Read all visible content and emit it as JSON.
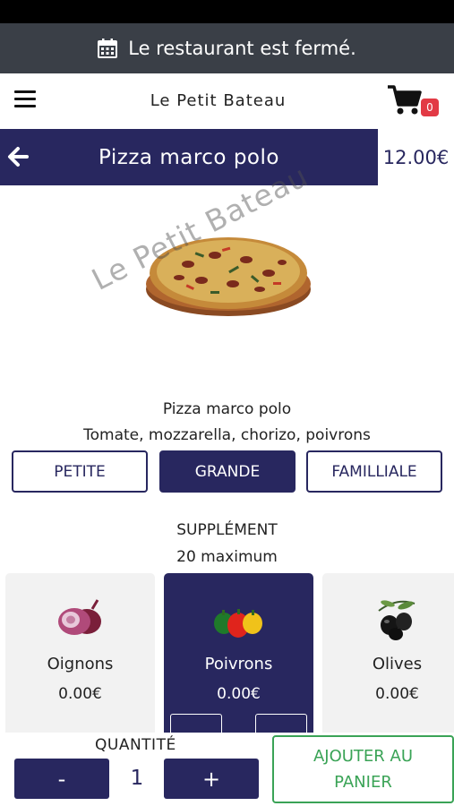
{
  "banner": {
    "text": "Le restaurant est fermé.",
    "icon": "calendar-icon"
  },
  "header": {
    "brand": "Le Petit Bateau",
    "cart_count": "0"
  },
  "product": {
    "title": "Pizza marco polo",
    "price": "12.00€",
    "watermark": "Le Petit Bateau",
    "name": "Pizza marco polo",
    "description": "Tomate, mozzarella, chorizo, poivrons"
  },
  "sizes": [
    {
      "label": "PETITE",
      "selected": false
    },
    {
      "label": "GRANDE",
      "selected": true
    },
    {
      "label": "FAMILLIALE",
      "selected": false
    }
  ],
  "supplements": {
    "title": "SUPPLÉMENT",
    "max": "20 maximum",
    "items": [
      {
        "name": "Oignons",
        "price": "0.00€",
        "icon": "onion-icon",
        "selected": false
      },
      {
        "name": "Poivrons",
        "price": "0.00€",
        "icon": "pepper-icon",
        "selected": true
      },
      {
        "name": "Olives",
        "price": "0.00€",
        "icon": "olive-icon",
        "selected": false
      }
    ]
  },
  "footer": {
    "quantity_label": "QUANTITÉ",
    "minus": "-",
    "quantity": "1",
    "plus": "+",
    "add_line1": "AJOUTER AU",
    "add_line2": "PANIER"
  },
  "colors": {
    "primary": "#28275f",
    "banner": "#3a3f47",
    "badge": "#e23a45",
    "add_button": "#3aa356"
  }
}
